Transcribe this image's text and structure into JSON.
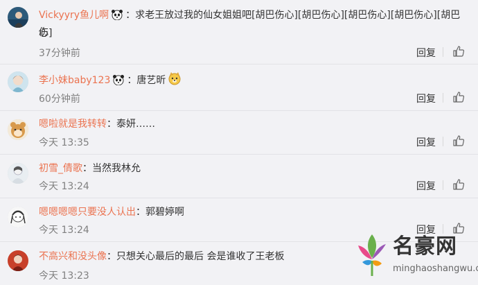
{
  "comments": [
    {
      "username": "Vickyyry鱼儿啊",
      "emoji": "panda-emoji",
      "separator": "：",
      "text": "求老王放过我的仙女姐姐吧[胡巴伤心][胡巴伤心][胡巴伤心][胡巴伤心][胡巴伤",
      "text_cont": "心]",
      "time": "37分钟前",
      "reply": "回复"
    },
    {
      "username": "李小妹baby123",
      "emoji": "panda-emoji",
      "separator": "：",
      "text": "唐艺昕",
      "trailing_emoji": "doge-emoji",
      "time": "60分钟前",
      "reply": "回复"
    },
    {
      "username": "嗯啦就是我转转",
      "separator": "：",
      "text": "泰妍……",
      "time": "今天 13:35",
      "reply": "回复"
    },
    {
      "username": "初雪_倩歌",
      "separator": "：",
      "text": "当然我林允",
      "time": "今天 13:24",
      "reply": "回复"
    },
    {
      "username": "嗯嗯嗯嗯只要没人认出",
      "separator": "：",
      "text": "郭碧婷啊",
      "time": "今天 13:24",
      "reply": "回复"
    },
    {
      "username": "不高兴和没头像",
      "separator": "：",
      "text": "只想关心最后的最后  会是谁收了王老板",
      "time": "今天 13:23",
      "reply": "回复"
    }
  ],
  "watermark": {
    "title": "名豪网",
    "url": "minghaoshangwu.com"
  },
  "colors": {
    "username": "#eb7350",
    "background": "#f2f2f5",
    "time": "#808080"
  }
}
